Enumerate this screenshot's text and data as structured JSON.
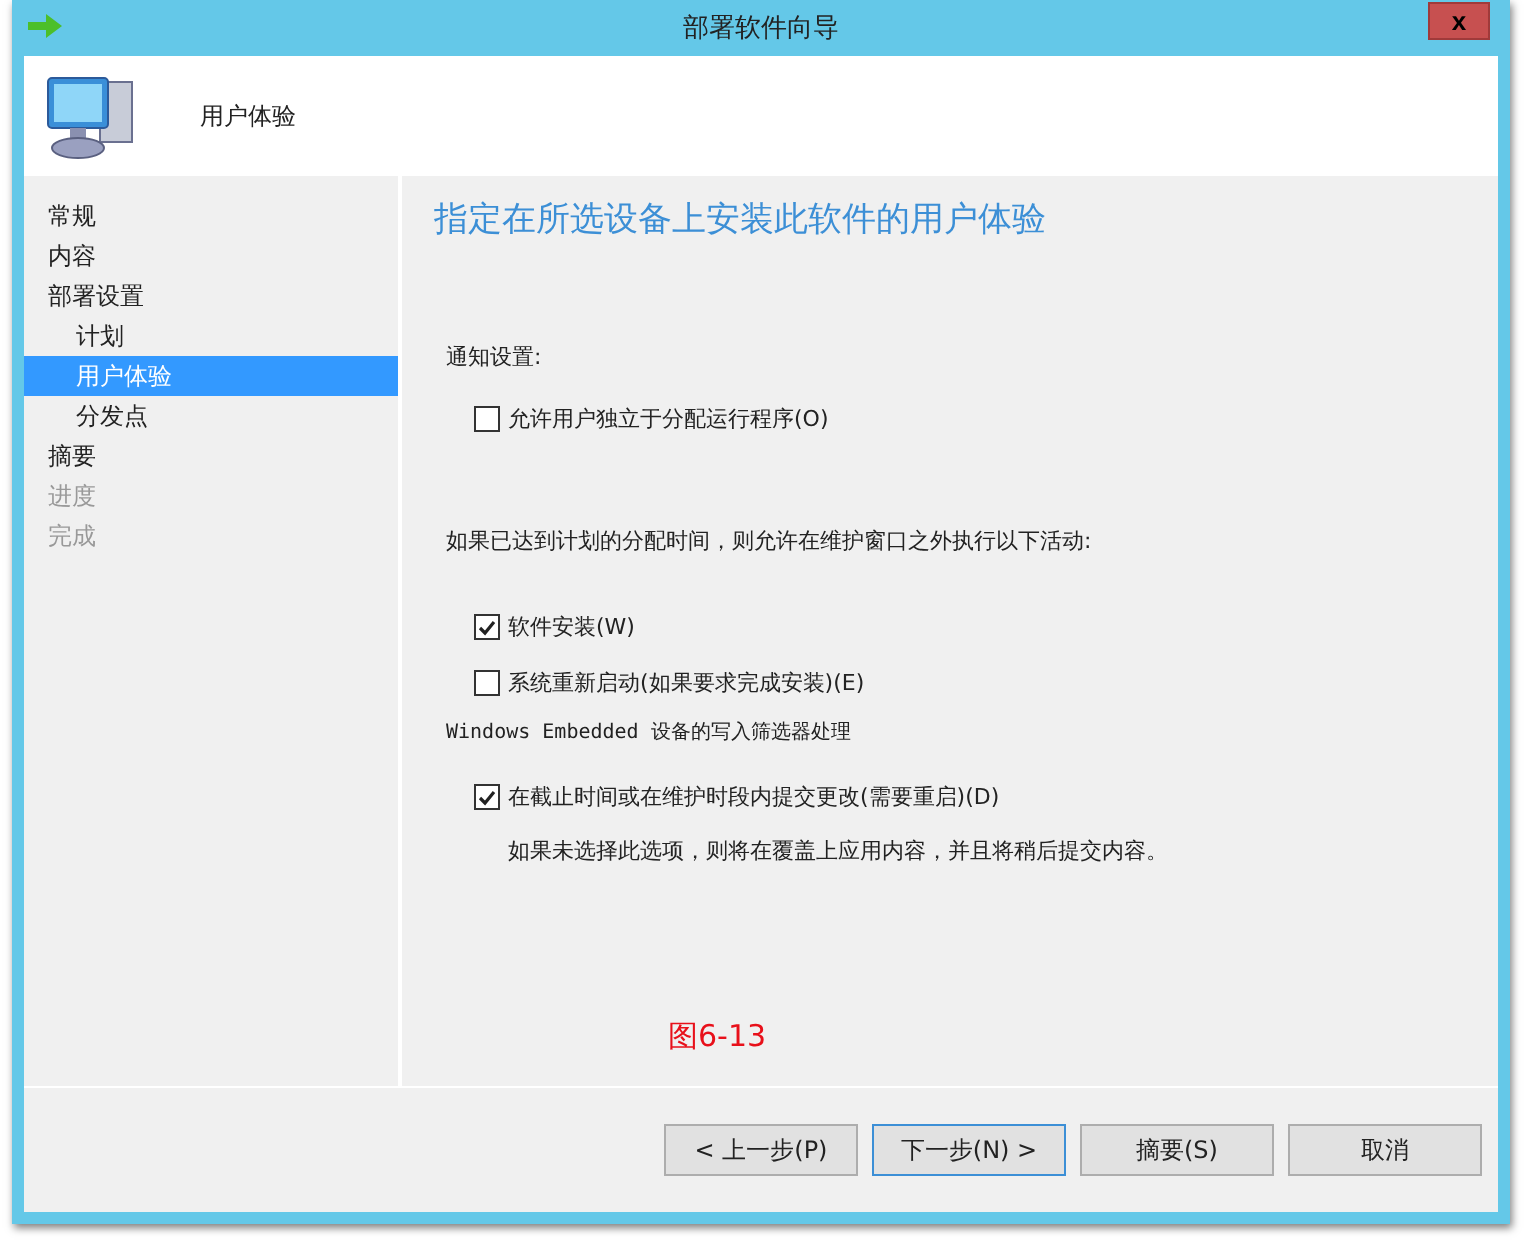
{
  "window": {
    "title": "部署软件向导",
    "close": "x"
  },
  "header": {
    "title": "用户体验"
  },
  "sidebar": {
    "items": [
      {
        "label": "常规",
        "selected": false,
        "disabled": false
      },
      {
        "label": "内容",
        "selected": false,
        "disabled": false
      },
      {
        "label": "部署设置",
        "selected": false,
        "disabled": false,
        "children": [
          {
            "label": "计划",
            "selected": false,
            "disabled": false
          },
          {
            "label": "用户体验",
            "selected": true,
            "disabled": false
          },
          {
            "label": "分发点",
            "selected": false,
            "disabled": false
          }
        ]
      },
      {
        "label": "摘要",
        "selected": false,
        "disabled": false
      },
      {
        "label": "进度",
        "selected": false,
        "disabled": true
      },
      {
        "label": "完成",
        "selected": false,
        "disabled": true
      }
    ]
  },
  "content": {
    "title": "指定在所选设备上安装此软件的用户体验",
    "sections": [
      {
        "heading": "通知设置:",
        "options": [
          {
            "label": "允许用户独立于分配运行程序(O)",
            "checked": false
          }
        ]
      },
      {
        "heading": "如果已达到计划的分配时间，则允许在维护窗口之外执行以下活动:",
        "options": [
          {
            "label": "软件安装(W)",
            "checked": true
          },
          {
            "label": "系统重新启动(如果要求完成安装)(E)",
            "checked": false
          }
        ]
      },
      {
        "heading": "Windows Embedded 设备的写入筛选器处理",
        "options": [
          {
            "label": "在截止时间或在维护时段内提交更改(需要重启)(D)",
            "checked": true,
            "note": "如果未选择此选项，则将在覆盖上应用内容，并且将稍后提交内容。"
          }
        ]
      }
    ],
    "figure_label": "图6-13"
  },
  "buttons": [
    {
      "label": "< 上一步(P)",
      "focused": false
    },
    {
      "label": "下一步(N) >",
      "focused": true
    },
    {
      "label": "摘要(S)",
      "focused": false
    },
    {
      "label": "取消",
      "focused": false
    }
  ]
}
